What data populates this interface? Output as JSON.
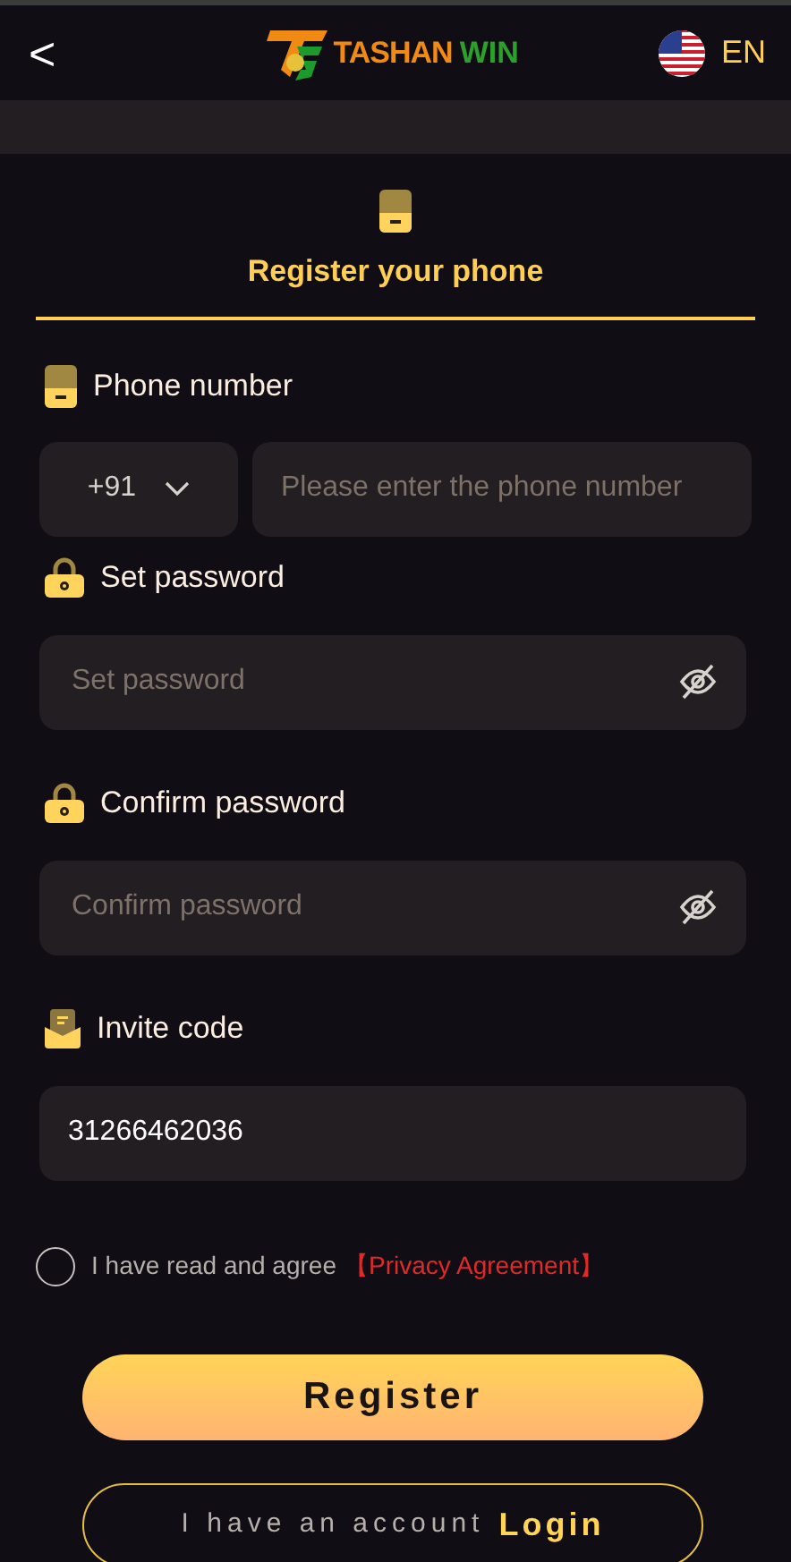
{
  "header": {
    "back": "<",
    "logo": {
      "part_1": "TASHAN",
      "part_2": "WIN"
    },
    "language": "EN"
  },
  "tab": {
    "label": "Register your phone",
    "selected": true
  },
  "form": [
    {
      "kind": "phone",
      "label": "Phone number",
      "code": "+91",
      "placeholder": "Please enter the phone number"
    },
    {
      "kind": "password",
      "label": "Set password",
      "placeholder": "Set password"
    },
    {
      "kind": "password",
      "label": "Confirm password",
      "placeholder": "Confirm password"
    },
    {
      "kind": "text",
      "label": "Invite code",
      "value": "31266462036"
    }
  ],
  "agreement": {
    "checked": false,
    "text": "I have read and agree",
    "link": "【Privacy Agreement】"
  },
  "register_button": "Register",
  "login": {
    "text": "I have an account",
    "link": "Login"
  }
}
